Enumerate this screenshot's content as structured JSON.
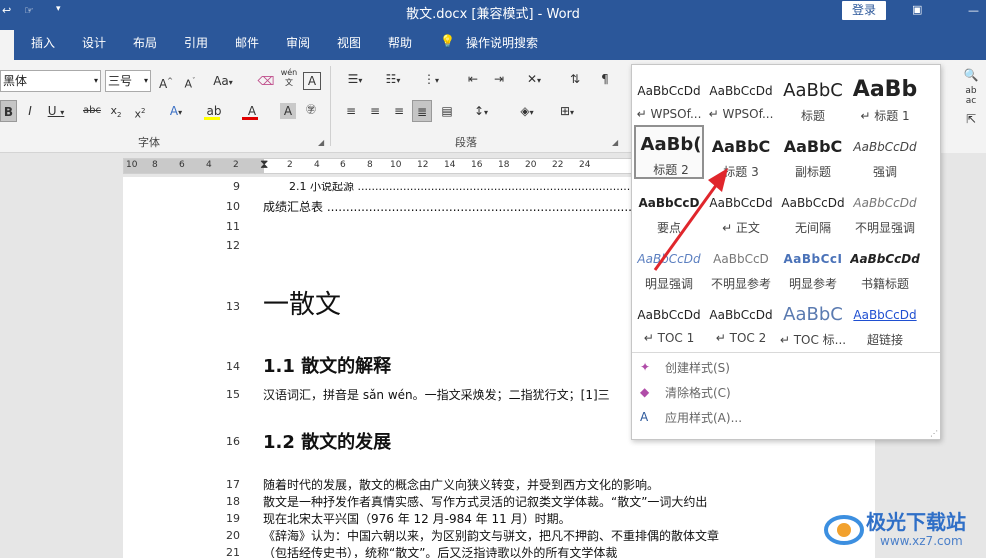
{
  "titlebar": {
    "title": "散文.docx [兼容模式] - Word",
    "login": "登录"
  },
  "tabs": [
    "插入",
    "设计",
    "布局",
    "引用",
    "邮件",
    "审阅",
    "视图",
    "帮助",
    "操作说明搜索"
  ],
  "font": {
    "name": "黑体",
    "size": "三号",
    "case_btn": "Aa",
    "group_label": "字体"
  },
  "paragraph": {
    "group_label": "段落"
  },
  "ruler": {
    "numbers": [
      "10",
      "8",
      "6",
      "4",
      "2",
      "2",
      "2",
      "4",
      "6",
      "8",
      "10",
      "12",
      "14",
      "16",
      "18",
      "20",
      "22",
      "24"
    ]
  },
  "document": {
    "lines": [
      {
        "no": "9",
        "text": "2.1 小说起源 ..........................................................................................."
      },
      {
        "no": "10",
        "text": "成绩汇总表 ..............................................................................................."
      },
      {
        "no": "11",
        "text": ""
      },
      {
        "no": "12",
        "text": ""
      },
      {
        "no": "13",
        "text": "一散文"
      },
      {
        "no": "14",
        "text": "1.1 散文的解释"
      },
      {
        "no": "15",
        "text": "汉语词汇，拼音是 sǎn wén。一指文采焕发；二指犹行文；[1]三"
      },
      {
        "no": "16",
        "text": "1.2 散文的发展"
      },
      {
        "no": "17",
        "text": "随着时代的发展，散文的概念由广义向狭义转变，并受到西方文化的影响。"
      },
      {
        "no": "18",
        "text": "散文是一种抒发作者真情实感、写作方式灵活的记叙类文学体裁。“散文”一词大约出"
      },
      {
        "no": "19",
        "text": "现在北宋太平兴国（976 年 12 月-984 年 11 月）时期。"
      },
      {
        "no": "20",
        "text": "《辞海》认为：中国六朝以来，为区别韵文与骈文，把凡不押韵、不重排偶的散体文章"
      },
      {
        "no": "21",
        "text": "（包括经传史书），统称“散文”。后又泛指诗歌以外的所有文学体裁"
      }
    ]
  },
  "styles_gallery": {
    "styles": [
      {
        "preview": "AaBbCcDd",
        "name": "↵ WPSOf..."
      },
      {
        "preview": "AaBbCcDd",
        "name": "↵ WPSOf..."
      },
      {
        "preview": "AaBbC",
        "name": "标题"
      },
      {
        "preview": "AaBb",
        "name": "↵ 标题 1"
      },
      {
        "preview": "AaBb(",
        "name": "标题 2"
      },
      {
        "preview": "AaBbC",
        "name": "标题 3"
      },
      {
        "preview": "AaBbC",
        "name": "副标题"
      },
      {
        "preview": "AaBbCcDd",
        "name": "强调"
      },
      {
        "preview": "AaBbCcD",
        "name": "要点"
      },
      {
        "preview": "AaBbCcDd",
        "name": "↵ 正文"
      },
      {
        "preview": "AaBbCcDd",
        "name": "无间隔"
      },
      {
        "preview": "AaBbCcDd",
        "name": "不明显强调"
      },
      {
        "preview": "AaBbCcDd",
        "name": "明显强调"
      },
      {
        "preview": "AaBbCcD",
        "name": "不明显参考"
      },
      {
        "preview": "AaBbCcI",
        "name": "明显参考"
      },
      {
        "preview": "AaBbCcDd",
        "name": "书籍标题"
      },
      {
        "preview": "AaBbCcDd",
        "name": "↵ TOC 1"
      },
      {
        "preview": "AaBbCcDd",
        "name": "↵ TOC 2"
      },
      {
        "preview": "AaBbC",
        "name": "↵ TOC 标..."
      },
      {
        "preview": "AaBbCcDd",
        "name": "超链接"
      }
    ],
    "actions": [
      "创建样式(S)",
      "清除格式(C)",
      "应用样式(A)..."
    ]
  },
  "watermark": {
    "text": "极光下载站",
    "url": "www.xz7.com"
  },
  "colors": {
    "word_blue": "#2b579a",
    "arrow": "#e0262c",
    "highlight": "#ffff00",
    "font_red": "#e00000"
  }
}
